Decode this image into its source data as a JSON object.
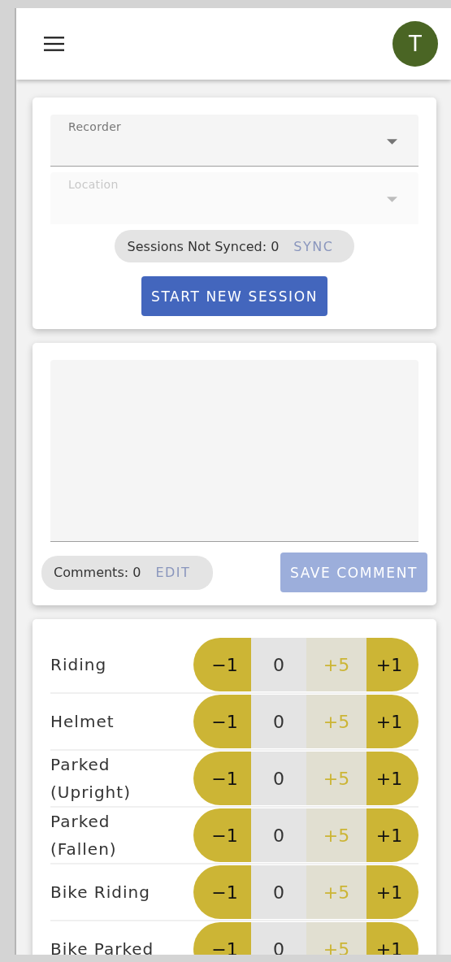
{
  "header": {
    "avatar": "T"
  },
  "session_card": {
    "fields": [
      {
        "label": "Recorder",
        "disabled": false
      },
      {
        "label": "Location",
        "disabled": true
      }
    ],
    "sync_chip": {
      "text": "Sessions Not Synced: 0",
      "action": "SYNC",
      "disabled": true
    },
    "start_button": {
      "label": "START NEW SESSION",
      "disabled": false
    }
  },
  "comment_card": {
    "comments_chip": {
      "text": "Comments: 0",
      "action": "EDIT",
      "disabled": true
    },
    "save_button": {
      "label": "SAVE COMMENT",
      "disabled": true
    }
  },
  "counters": [
    {
      "label": "Riding",
      "controls": [
        {
          "kind": "minus",
          "label": "−1"
        },
        {
          "kind": "value",
          "label": "0"
        },
        {
          "kind": "plus5",
          "label": "+5"
        },
        {
          "kind": "plus",
          "label": "+1"
        }
      ]
    },
    {
      "label": "Helmet",
      "controls": [
        {
          "kind": "minus",
          "label": "−1"
        },
        {
          "kind": "value",
          "label": "0"
        },
        {
          "kind": "plus5",
          "label": "+5"
        },
        {
          "kind": "plus",
          "label": "+1"
        }
      ]
    },
    {
      "label": "Parked (Upright)",
      "controls": [
        {
          "kind": "minus",
          "label": "−1"
        },
        {
          "kind": "value",
          "label": "0"
        },
        {
          "kind": "plus5",
          "label": "+5"
        },
        {
          "kind": "plus",
          "label": "+1"
        }
      ]
    },
    {
      "label": "Parked (Fallen)",
      "controls": [
        {
          "kind": "minus",
          "label": "−1"
        },
        {
          "kind": "value",
          "label": "0"
        },
        {
          "kind": "plus5",
          "label": "+5"
        },
        {
          "kind": "plus",
          "label": "+1"
        }
      ]
    },
    {
      "label": "Bike Riding",
      "controls": [
        {
          "kind": "minus",
          "label": "−1"
        },
        {
          "kind": "value",
          "label": "0"
        },
        {
          "kind": "plus5",
          "label": "+5"
        },
        {
          "kind": "plus",
          "label": "+1"
        }
      ]
    },
    {
      "label": "Bike Parked",
      "controls": [
        {
          "kind": "minus",
          "label": "−1"
        },
        {
          "kind": "value",
          "label": "0"
        },
        {
          "kind": "plus5",
          "label": "+5"
        },
        {
          "kind": "plus",
          "label": "+1"
        }
      ]
    }
  ]
}
